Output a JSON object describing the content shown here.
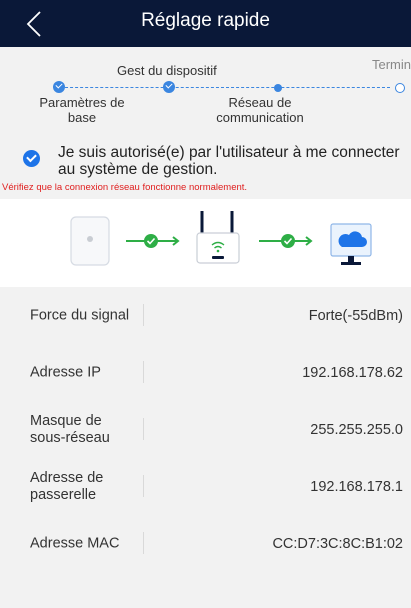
{
  "header": {
    "title": "Réglage rapide",
    "back_icon": "chevron-left-icon"
  },
  "steps": {
    "items": [
      {
        "label": "Paramètres de base",
        "line1": "Paramètres de",
        "line2": "base",
        "status": "done"
      },
      {
        "label": "Gest du dispositif",
        "status": "done"
      },
      {
        "label": "Réseau de communication",
        "line1": "Réseau de",
        "line2": "communication",
        "status": "current"
      },
      {
        "label": "Termin",
        "status": "todo"
      }
    ]
  },
  "consent": {
    "checked": true,
    "text": "Je suis autorisé(e) par l'utilisateur à me connecter au système de gestion."
  },
  "warning": "Vérifiez que la connexion réseau fonctionne normalement.",
  "topology": {
    "nodes": [
      {
        "icon": "access-point-icon"
      },
      {
        "icon": "router-icon"
      },
      {
        "icon": "cloud-monitor-icon"
      }
    ],
    "links": [
      {
        "icon": "check-icon",
        "status": "ok"
      },
      {
        "icon": "check-icon",
        "status": "ok"
      }
    ],
    "colors": {
      "link": "#2eae46",
      "accent": "#1e74e8"
    }
  },
  "info": {
    "rows": [
      {
        "label": "Force du signal",
        "value": "Forte(-55dBm)"
      },
      {
        "label": "Adresse IP",
        "value": "192.168.178.62"
      },
      {
        "label": "Masque de sous-réseau",
        "value": "255.255.255.0"
      },
      {
        "label": "Adresse de passerelle",
        "value": "192.168.178.1"
      },
      {
        "label": "Adresse MAC",
        "value": "CC:D7:3C:8C:B1:02"
      }
    ]
  },
  "colors": {
    "header_bg": "#0a1838",
    "accent": "#3b86e0",
    "warning": "#e02020",
    "success": "#2eae46"
  }
}
